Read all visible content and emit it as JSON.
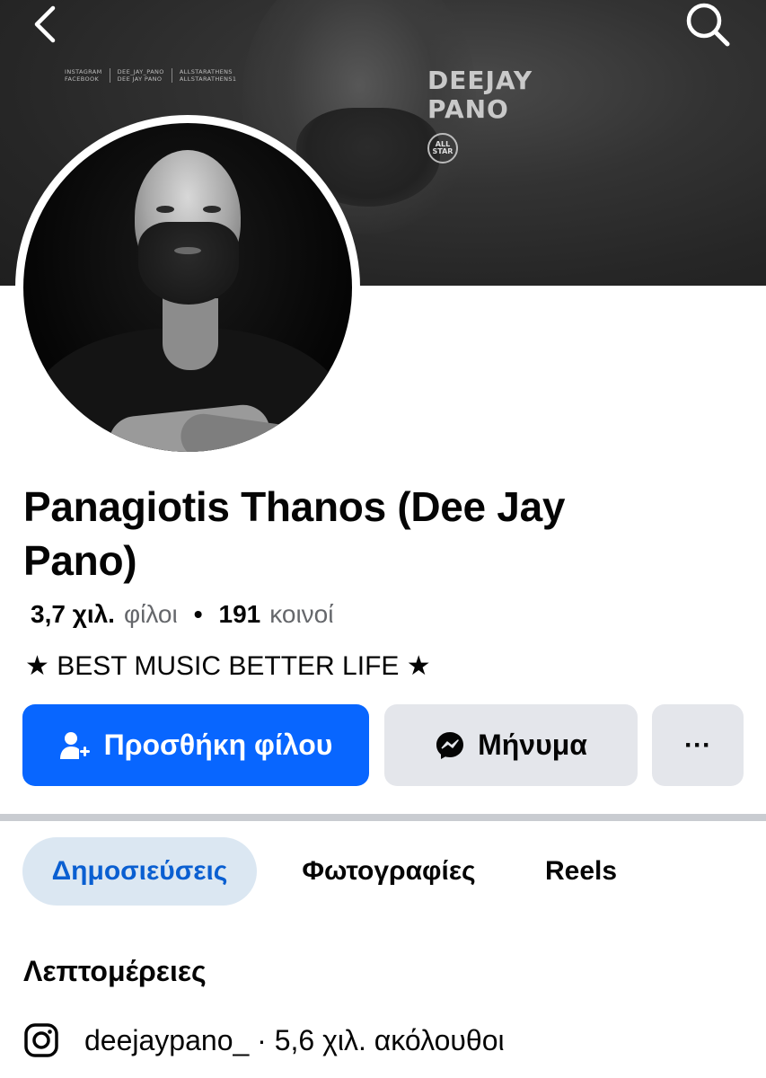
{
  "header": {
    "back_icon": "chevron-left-icon",
    "search_icon": "search-icon"
  },
  "cover": {
    "social_left": [
      "INSTAGRAM",
      "FACEBOOK"
    ],
    "social_mid": [
      "DEE_JAY_PANO",
      "DEE JAY PANO"
    ],
    "social_right": [
      "ALLSTARATHENS",
      "ALLSTARATHENS1"
    ],
    "brand_line1": "DEEJAY",
    "brand_line2": "PANO",
    "logo_text": "ALL STAR"
  },
  "profile": {
    "name": "Panagiotis Thanos (Dee Jay Pano)",
    "friends_count": "3,7 χιλ.",
    "friends_label": "φίλοι",
    "separator": "•",
    "mutual_count": "191",
    "mutual_label": "κοινοί",
    "bio": "★ BEST MUSIC BETTER LIFE ★"
  },
  "actions": {
    "add_friend_label": "Προσθήκη φίλου",
    "add_friend_icon": "person-add-icon",
    "message_label": "Μήνυμα",
    "message_icon": "messenger-icon",
    "more_label": "···"
  },
  "tabs": [
    {
      "label": "Δημοσιεύσεις",
      "active": true
    },
    {
      "label": "Φωτογραφίες",
      "active": false
    },
    {
      "label": "Reels",
      "active": false
    }
  ],
  "details": {
    "title": "Λεπτομέρειες",
    "instagram_icon": "instagram-icon",
    "instagram_text": "deejaypano_ · 5,6 χιλ. ακόλουθοι"
  },
  "colors": {
    "accent": "#0866ff",
    "secondary_button": "#e4e6eb",
    "active_tab_bg": "#dbe7f2",
    "active_tab_text": "#0a5fd1",
    "muted_text": "#65676b"
  }
}
